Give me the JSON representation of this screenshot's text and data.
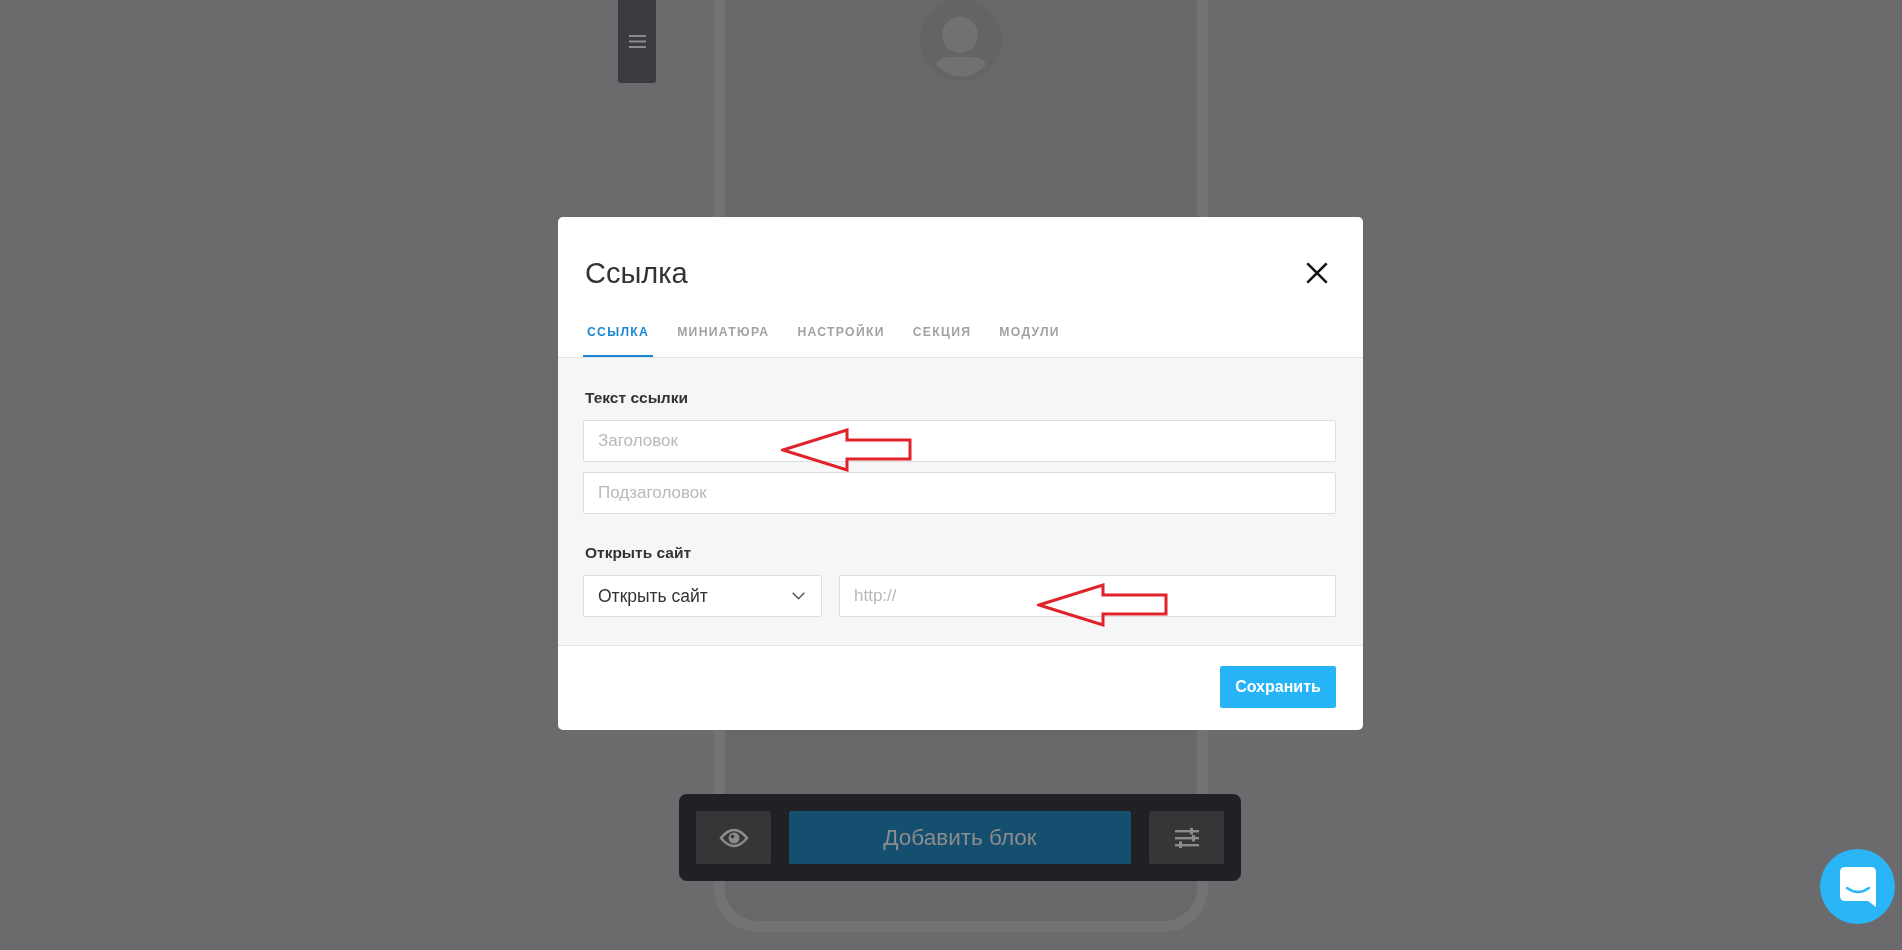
{
  "editor": {
    "add_block_button": "Добавить блок"
  },
  "dialog": {
    "title": "Ссылка",
    "tabs": [
      {
        "label": "ССЫЛКА",
        "selected": true
      },
      {
        "label": "МИНИАТЮРА",
        "selected": false
      },
      {
        "label": "НАСТРОЙКИ",
        "selected": false
      },
      {
        "label": "СЕКЦИЯ",
        "selected": false
      },
      {
        "label": "МОДУЛИ",
        "selected": false
      }
    ],
    "sections": [
      {
        "label": "Текст ссылки",
        "inline": false,
        "fields": [
          {
            "kind": "input",
            "placeholder": "Заголовок",
            "annotated": true
          },
          {
            "kind": "input",
            "placeholder": "Подзаголовок",
            "annotated": false
          }
        ]
      },
      {
        "label": "Открыть сайт",
        "inline": true,
        "fields": [
          {
            "kind": "select",
            "value": "Открыть сайт",
            "annotated": false
          },
          {
            "kind": "input",
            "placeholder": "http://",
            "annotated": true
          }
        ]
      }
    ],
    "save_button": "Сохранить"
  }
}
